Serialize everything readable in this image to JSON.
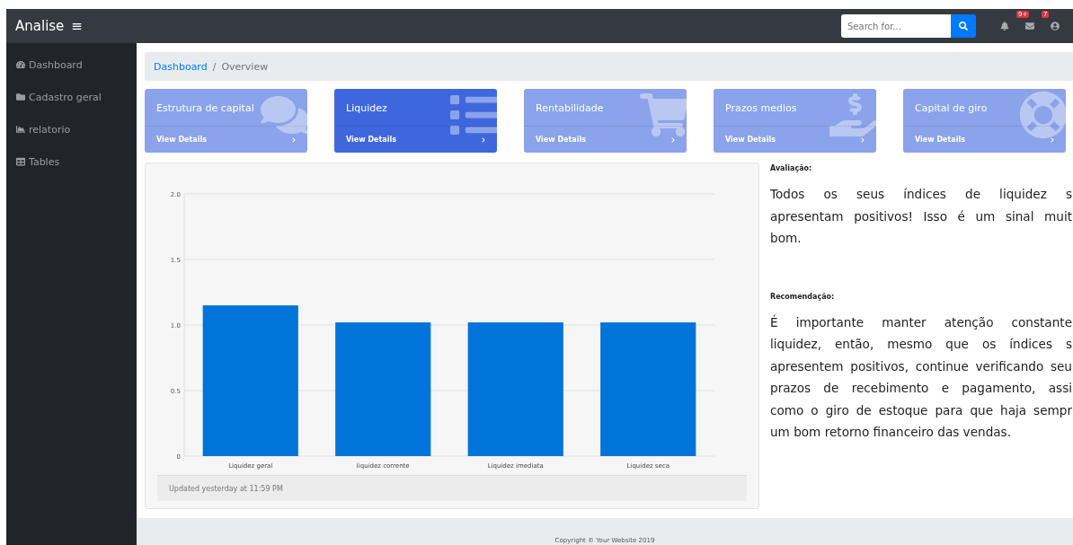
{
  "navbar": {
    "brand": "Analise",
    "menu_icon": "≡",
    "search": {
      "placeholder": "Search for..."
    },
    "alerts": [
      {
        "kind": "bell"
      },
      {
        "kind": "mail",
        "badge": "9+"
      },
      {
        "kind": "user",
        "badge": "7"
      }
    ]
  },
  "sidebar": {
    "items": [
      {
        "kind": "dashboard",
        "label": "Dashboard"
      },
      {
        "kind": "folder",
        "label": "Cadastro geral"
      },
      {
        "kind": "chart",
        "label": "relatorio"
      },
      {
        "kind": "table",
        "label": "Tables"
      }
    ]
  },
  "breadcrumb": {
    "separator": "/",
    "items": [
      "Dashboard",
      "Overview"
    ]
  },
  "cards": [
    {
      "kind": "comments",
      "title": "Estrutura de capital",
      "link": "View Details",
      "selected": false
    },
    {
      "kind": "list",
      "title": "Liquidez",
      "link": "View Details",
      "selected": true
    },
    {
      "kind": "cart",
      "title": "Rentabilidade",
      "link": "View Details",
      "selected": false
    },
    {
      "kind": "money",
      "title": "Prazos medios",
      "link": "View Details",
      "selected": false
    },
    {
      "kind": "lifering",
      "title": "Capital de giro",
      "link": "View Details",
      "selected": false
    }
  ],
  "chart_card": {
    "chart_data": {
      "type": "bar",
      "categories": [
        "Liquidez geral",
        "liquidez corrente",
        "Liquidez imediata",
        "Liquidez seca"
      ],
      "series": [
        {
          "color": "#0074d9",
          "values": [
            1.15,
            1.02,
            1.02,
            1.02
          ]
        }
      ],
      "grid": true,
      "ylim": [
        0,
        2
      ],
      "yticks": [
        {
          "value": 0,
          "label": "0"
        },
        {
          "value": 0.5,
          "label": "0.5"
        },
        {
          "value": 1,
          "label": "1.0"
        },
        {
          "value": 1.5,
          "label": "1.5"
        },
        {
          "value": 2,
          "label": "2.0"
        }
      ]
    },
    "footer": "Updated yesterday at 11:59 PM"
  },
  "assessment": {
    "heading": "Avaliação:",
    "lines": [
      "Todos os seus índices de liquidez s",
      "apresentam positivos! Isso é um sinal muit",
      "bom."
    ]
  },
  "recommendation": {
    "heading": "Recomendação:",
    "lines": [
      "É importante manter atenção constante",
      "liquidez, então, mesmo que os índices s",
      "apresentem positivos, continue verificando seu",
      "prazos de recebimento e pagamento, assi",
      "como o giro de estoque para que haja sempr",
      "um bom retorno financeiro das vendas."
    ]
  },
  "footer": "Copyright © Your Website 2019"
}
